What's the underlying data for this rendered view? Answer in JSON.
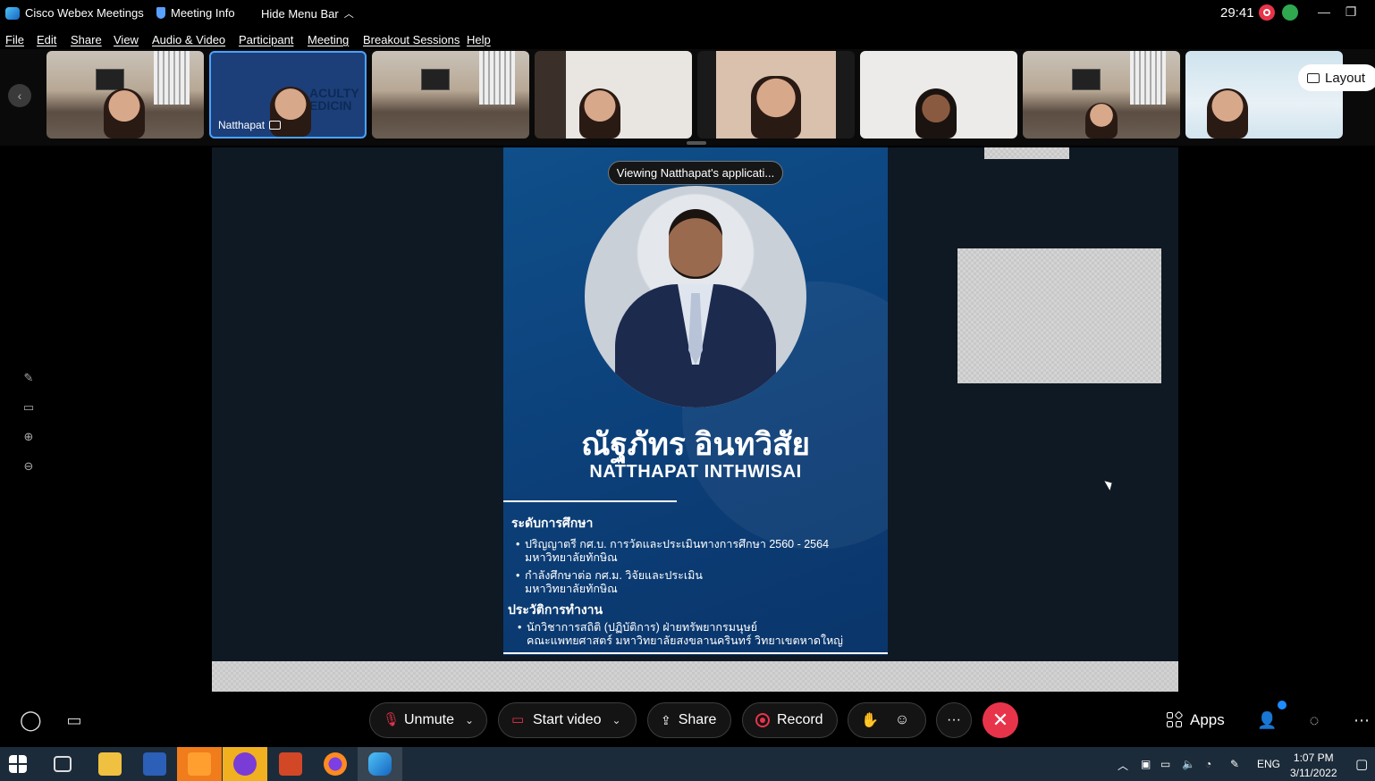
{
  "titlebar": {
    "app_name": "Cisco Webex Meetings",
    "meeting_info": "Meeting Info",
    "hide_menu": "Hide Menu Bar",
    "timer": "29:41"
  },
  "menu": [
    "File",
    "Edit",
    "Share",
    "View",
    "Audio & Video",
    "Participant",
    "Meeting",
    "Breakout Sessions",
    "Help"
  ],
  "participants": {
    "active_name": "Natthapat",
    "active_bg_text": "ACULTY\nEDICIN",
    "layout_label": "Layout"
  },
  "shared": {
    "tooltip": "Viewing Natthapat's applicati...",
    "poster": {
      "name_th": "ณัฐภัทร อินทวิสัย",
      "name_en": "NATTHAPAT INTHWISAI",
      "education_title": "ระดับการศึกษา",
      "education": [
        {
          "line1": "ปริญญาตรี กศ.บ. การวัดและประเมินทางการศึกษา 2560 - 2564",
          "line2": "มหาวิทยาลัยทักษิณ"
        },
        {
          "line1": "กำลังศึกษาต่อ กศ.ม. วิจัยและประเมิน",
          "line2": "มหาวิทยาลัยทักษิณ"
        }
      ],
      "work_title": "ประวัติการทำงาน",
      "work": [
        {
          "line1": "นักวิชาการสถิติ (ปฏิบัติการ) ฝ่ายทรัพยากรมนุษย์",
          "line2": "คณะแพทยศาสตร์ มหาวิทยาลัยสงขลานครินทร์ วิทยาเขตหาดใหญ่"
        }
      ]
    }
  },
  "controls": {
    "unmute": "Unmute",
    "start_video": "Start video",
    "share": "Share",
    "record": "Record",
    "more": "···",
    "apps": "Apps"
  },
  "taskbar": {
    "lang": "ENG",
    "time": "1:07 PM",
    "date": "3/11/2022"
  },
  "colors": {
    "accent": "#4aa3ff",
    "danger": "#e8344a",
    "poster_blue": "#0c3f78"
  }
}
